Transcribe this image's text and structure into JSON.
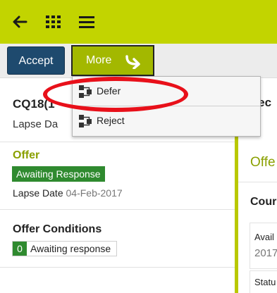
{
  "toolbar": {
    "back_icon": "arrow-left-icon",
    "apps_icon": "grid-icon",
    "menu_icon": "hamburger-icon"
  },
  "actions": {
    "accept_label": "Accept",
    "more_label": "More",
    "more_icon": "forward-arrow-icon"
  },
  "dropdown": {
    "items": [
      {
        "label": "Defer",
        "icon": "workflow-icon"
      },
      {
        "label": "Reject",
        "icon": "workflow-icon"
      }
    ]
  },
  "card": {
    "title": "CQ18(1",
    "lapse_partial": "Lapse Da"
  },
  "offer": {
    "label": "Offer",
    "status": "Awaiting Response",
    "lapse_label": "Lapse Date",
    "lapse_date": "04-Feb-2017"
  },
  "conditions": {
    "title": "Offer Conditions",
    "count": "0",
    "status": "Awaiting response"
  },
  "right_panel": {
    "header_partial": "Tec",
    "offer_partial": "Offe",
    "course_partial": "Cour",
    "avail_label_partial": "Avail",
    "avail_value_partial": "2017",
    "status_label_partial": "Statu"
  },
  "colors": {
    "topbar": "#c2d400",
    "accept": "#1e4a6e",
    "more": "#a3b800",
    "badge_green": "#2f8a2f",
    "highlight": "#e8101a"
  }
}
